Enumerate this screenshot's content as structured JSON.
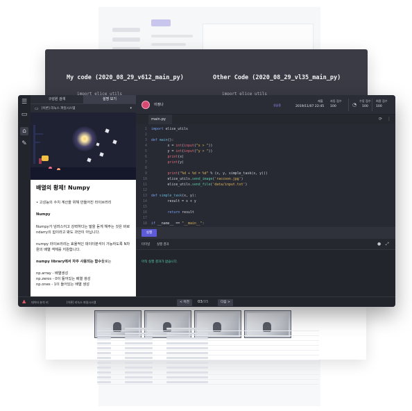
{
  "compare": {
    "left_title": "My code (2020_08_29_v612_main_py)",
    "right_title": "Other Code (2020_08_29_vl35_main_py)",
    "left_line": "import elice_utils",
    "right_line": "import elice_utils"
  },
  "lesson": {
    "tabs": [
      "구성원 검색",
      "설명 보기"
    ],
    "system_select": "[이론] 리눅스 파일시스템",
    "heading": "배열의 황제! Numpy",
    "bullet": "• 고성능의 수치 계산을 위해 만들어진 라이브러리",
    "subheading": "Numpy",
    "para1": "Numpy가 넘려스어고 강력하다는 말을 듣게 해주는 것은 바로 ndarry의 힘이라고 봐도 과언이 아닙니다.",
    "para2": "numpy 라이브러리는 효율적인 데이터분석이 가능하도록 N차원의 배열 객체를 지원합니다.",
    "bold_line_b": "numpy library에서 자주 사용되는 함수",
    "bold_line_rest": "들로는",
    "list_lines": [
      "np.array - 배열생성",
      "np.zeros - 0이 들어있는 배열 생성",
      "np.ones - 1이 들어있는 배열 생성"
    ]
  },
  "header": {
    "user_name": "이정나",
    "status_tag": "실습중",
    "submitted_label": "제출",
    "submitted_value": "2019/11/07 22:45",
    "auto_score_label": "자동 점수",
    "auto_score_value": "100",
    "manual_score_label": "수동 점수",
    "manual_score_value": "100",
    "final_score_label": "최종 점수",
    "final_score_value": "100"
  },
  "editor": {
    "file_tab": "main.py",
    "line_numbers": [
      "1",
      "2",
      "3",
      "4",
      "5",
      "6",
      "7",
      "8",
      "9",
      "10",
      "11",
      "12",
      "13",
      "14",
      "15",
      "16",
      "17",
      "18",
      "19"
    ]
  },
  "run": {
    "run_label": "실행"
  },
  "output": {
    "tab_terminal": "터미널",
    "tab_result": "실행 결과",
    "message": "아직 실행 결과가 없습니다."
  },
  "status": {
    "left_text": "데이터 분석 리",
    "course_text": "[이론] 리눅스 파일시스템",
    "prev_label": "< 이전",
    "next_label": "다음 >",
    "page_current": "03",
    "page_total": "05"
  },
  "icons": {
    "menu": "menu-icon",
    "book": "book-icon",
    "home": "home-icon",
    "pencil": "pencil-icon"
  },
  "colors": {
    "accent": "#5d5bd8",
    "mint": "#58c9a6",
    "warn": "#e45b67"
  }
}
